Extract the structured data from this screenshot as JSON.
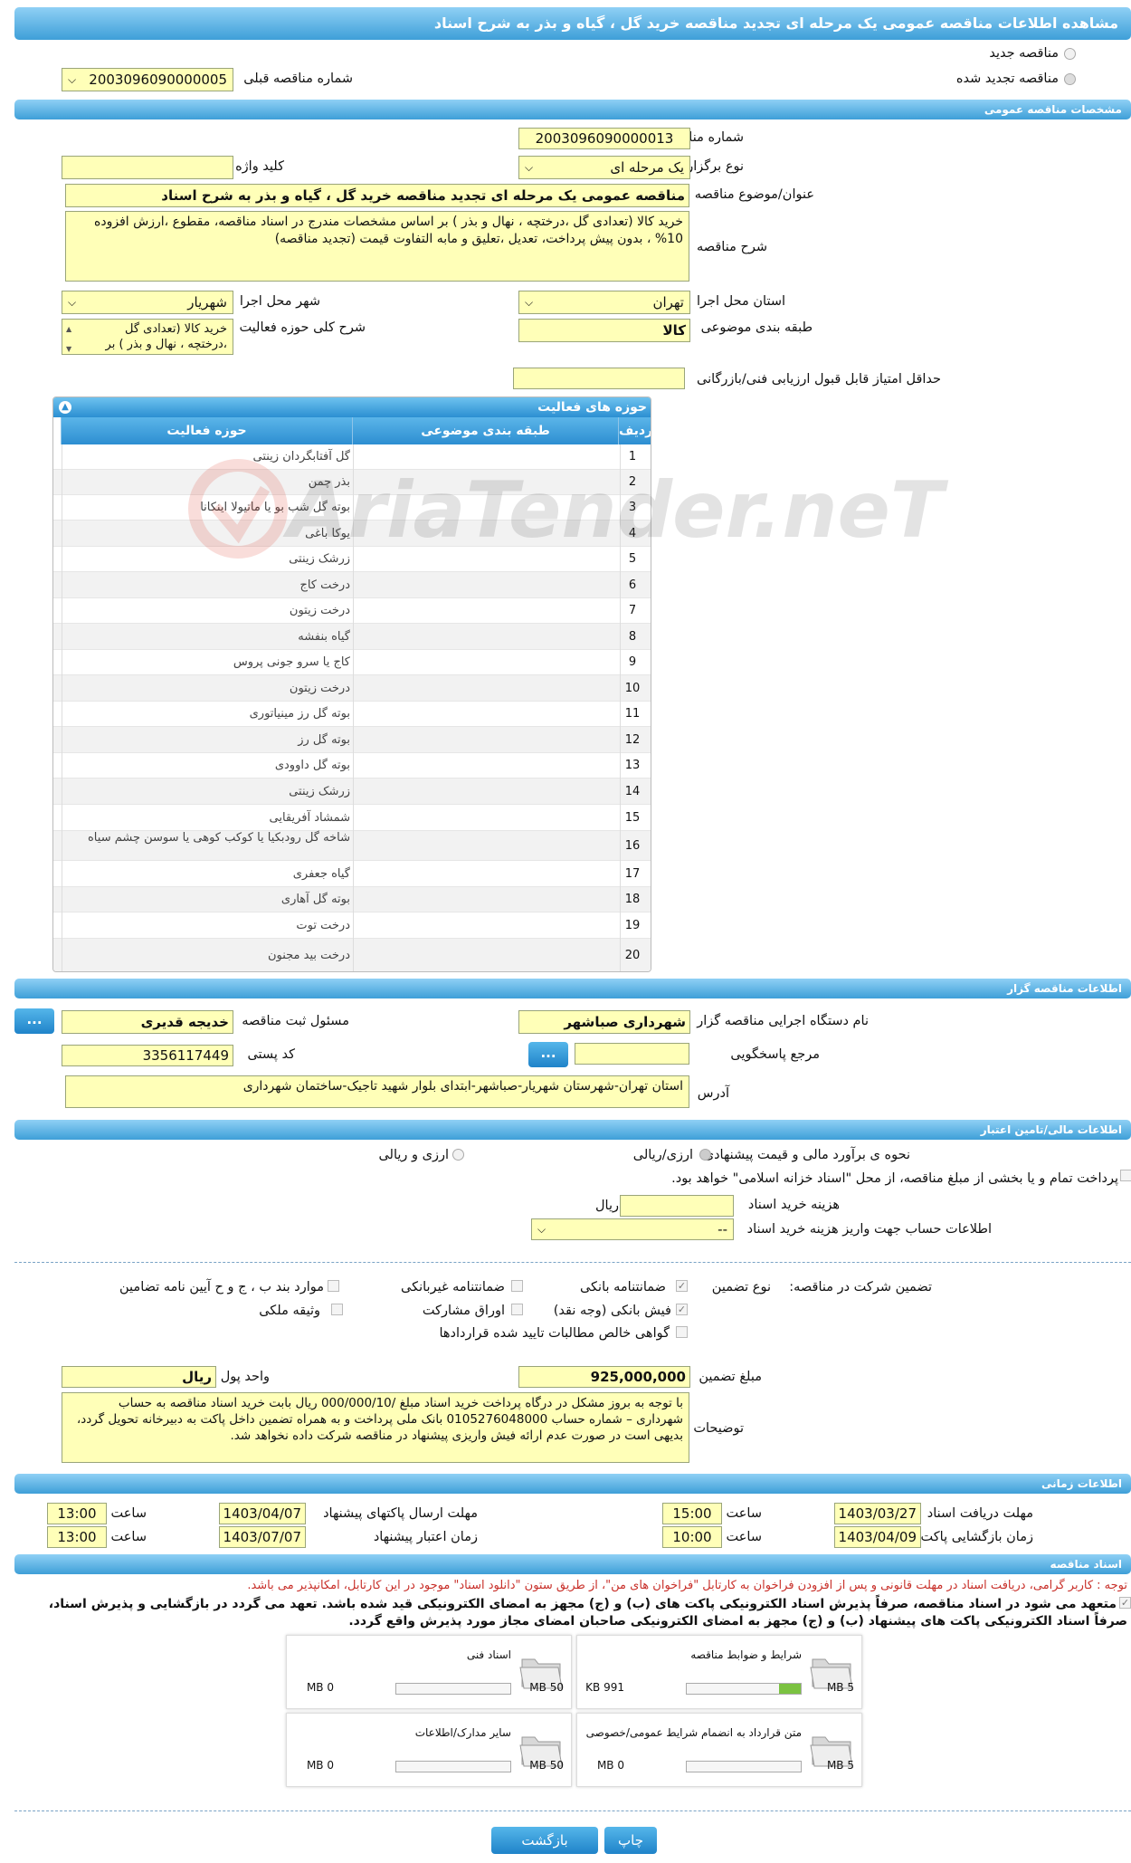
{
  "title": "مشاهده اطلاعات مناقصه عمومی یک مرحله ای تجدید مناقصه خرید گل ، گیاه و بذر به شرح اسناد",
  "radios": {
    "new": "مناقصه جدید",
    "renewed": "مناقصه تجدید شده"
  },
  "prev_tender": {
    "label": "شماره مناقصه قبلی",
    "value": "2003096090000005"
  },
  "sections": {
    "general": "مشخصات مناقصه عمومی",
    "organizer": "اطلاعات مناقصه گزار",
    "finance": "اطلاعات مالی/تامین اعتبار",
    "timing": "اطلاعات زمانی",
    "docs": "اسناد مناقصه"
  },
  "general": {
    "tender_no_label": "شماره مناقصه",
    "tender_no": "2003096090000013",
    "holding_type_label": "نوع برگزاری",
    "holding_type": "یک مرحله ای",
    "keyword_label": "کلید واژه",
    "keyword": "",
    "subject_label": "عنوان/موضوع مناقصه",
    "subject": "مناقصه عمومی یک مرحله ای تجدید مناقصه خرید گل ، گیاه و بذر به شرح اسناد",
    "desc_label": "شرح مناقصه",
    "desc": "خرید کالا (تعدادی گل ،درختچه ، نهال و بذر ) بر اساس مشخصات مندرج در اسناد مناقصه، مقطوع ،ارزش افزوده 10% ، بدون پیش پرداخت، تعدیل ،تعلیق و مابه التفاوت قیمت (تجدید مناقصه)",
    "province_label": "استان محل اجرا",
    "province": "تهران",
    "city_label": "شهر محل اجرا",
    "city": "شهریار",
    "category_label": "طبقه بندی موضوعی",
    "category": "کالا",
    "activity_desc_label": "شرح کلی حوزه فعالیت",
    "activity_desc": "خرید کالا (تعدادی گل ،درختچه ، نهال و بذر ) بر",
    "min_score_label": "حداقل امتیاز قابل قبول ارزیابی فنی/بازرگانی",
    "min_score": ""
  },
  "grid": {
    "title": "حوزه های فعالیت",
    "col_row": "ردیف",
    "col_cat": "طبقه بندی موضوعی",
    "col_act": "حوزه فعالیت",
    "rows": [
      {
        "n": "1",
        "a": "گل آفتابگردان زینتی"
      },
      {
        "n": "2",
        "a": "بذر چمن"
      },
      {
        "n": "3",
        "a": "بوته گل شب بو یا ماتیولا اینکانا"
      },
      {
        "n": "4",
        "a": "یوکا باغی"
      },
      {
        "n": "5",
        "a": "زرشک زینتی"
      },
      {
        "n": "6",
        "a": "درخت کاج"
      },
      {
        "n": "7",
        "a": "درخت زیتون"
      },
      {
        "n": "8",
        "a": "گیاه بنفشه"
      },
      {
        "n": "9",
        "a": "کاج یا سرو جونی پروس"
      },
      {
        "n": "10",
        "a": "درخت زیتون"
      },
      {
        "n": "11",
        "a": "بوته گل رز مینیاتوری"
      },
      {
        "n": "12",
        "a": "بوته گل رز"
      },
      {
        "n": "13",
        "a": "بوته گل داوودی"
      },
      {
        "n": "14",
        "a": "زرشک زینتی"
      },
      {
        "n": "15",
        "a": "شمشاد آفریقایی"
      },
      {
        "n": "16",
        "a": "شاخه گل رودبکیا یا کوکب کوهی یا سوسن چشم سیاه"
      },
      {
        "n": "17",
        "a": "گیاه جعفری"
      },
      {
        "n": "18",
        "a": "بوته گل آهاری"
      },
      {
        "n": "19",
        "a": "درخت توت"
      },
      {
        "n": "20",
        "a": "درخت بید مجنون"
      }
    ]
  },
  "watermark": "AriaTender.neT",
  "organizer": {
    "org_label": "نام دستگاه اجرایی مناقصه گزار",
    "org": "شهرداری صباشهر",
    "resp_label": "مسئول ثبت مناقصه",
    "resp": "خدیجه قدیری",
    "ref_label": "مرجع پاسخگویی",
    "ref": "",
    "postal_label": "کد پستی",
    "postal": "3356117449",
    "address_label": "آدرس",
    "address": "استان تهران-شهرستان شهریار-صباشهر-ابتدای بلوار شهید تاجیک-ساختمان شهرداری",
    "more": "..."
  },
  "finance": {
    "estimate_label": "نحوه ی برآورد مالی و قیمت پیشنهادی",
    "opt_rial": "ارزی/ریالی",
    "opt_fx": "ارزی و ریالی",
    "treasury_text": "پرداخت تمام و یا بخشی از مبلغ مناقصه، از محل \"اسناد خزانه اسلامی\" خواهد بود.",
    "doc_fee_label": "هزینه خرید اسناد",
    "doc_fee": "",
    "doc_fee_unit": "ریال",
    "account_label": "اطلاعات حساب جهت واریز هزینه خرید اسناد",
    "account": "--",
    "guarantee_label": "تضمین شرکت در مناقصه:",
    "guarantee_type_label": "نوع تضمین",
    "g_bank": "ضمانتنامه بانکی",
    "g_nonbank": "ضمانتنامه غیربانکی",
    "g_other": "موارد بند ب ، ج و ح آیین نامه تضامین",
    "g_check": "فیش بانکی (وجه نقد)",
    "g_bonds": "اوراق مشارکت",
    "g_property": "وثیقه ملکی",
    "g_claims": "گواهی خالص مطالبات تایید شده قراردادها",
    "amount_label": "مبلغ تضمین",
    "amount": "925,000,000",
    "currency_label": "واحد پول",
    "currency": "ریال",
    "notes_label": "توضیحات",
    "notes": "با توجه به بروز مشکل در درگاه پرداخت خرید اسناد مبلغ /000/000/10 ریال بابت خرید اسناد مناقصه به حساب شهرداری – شماره حساب 0105276048000 بانک ملی پرداخت و به همراه تضمین داخل پاکت به دبیرخانه تحویل گردد، بدیهی است در صورت عدم ارائه فیش واریزی پیشنهاد در مناقصه شرکت داده نخواهد شد."
  },
  "timing": {
    "doc_deadline_label": "مهلت دریافت اسناد",
    "doc_deadline": "1403/03/27",
    "time_label": "ساعت",
    "doc_time": "15:00",
    "send_deadline_label": "مهلت ارسال پاکتهای پیشنهاد",
    "send_deadline": "1403/04/07",
    "send_time": "13:00",
    "open_label": "زمان بازگشایی پاکت ها",
    "open_date": "1403/04/09",
    "open_time": "10:00",
    "valid_label": "زمان اعتبار پیشنهاد",
    "valid_date": "1403/07/07",
    "valid_time": "13:00"
  },
  "docs": {
    "notice": "توجه : کاربر گرامی، دریافت اسناد در مهلت قانونی و پس از افزودن فراخوان به کارتابل \"فراخوان های من\"، از طریق ستون \"دانلود اسناد\" موجود در این کارتابل، امکانپذیر می باشد.",
    "commit1": "متعهد می شود در اسناد مناقصه، صرفاً پذیرش اسناد الکترونیکی پاکت های (ب) و (ج) مجهز به امضای الکترونیکی قید شده باشد. تعهد می گردد در بازگشایی و پذیرش اسناد،",
    "commit2": "صرفاً اسناد الکترونیکی پاکت های پیشنهاد (ب) و (ج) مجهز به امضای الکترونیکی صاحبان امضای مجاز مورد پذیرش واقع گردد.",
    "files": [
      {
        "name": "شرایط و ضوابط مناقصه",
        "used": "991 KB",
        "max": "5 MB",
        "frac": 0.19
      },
      {
        "name": "اسناد فنی",
        "used": "0 MB",
        "max": "50 MB",
        "frac": 0
      },
      {
        "name": "متن قرارداد به انضمام شرایط عمومی/خصوصی",
        "used": "0 MB",
        "max": "5 MB",
        "frac": 0
      },
      {
        "name": "سایر مدارک/اطلاعات",
        "used": "0 MB",
        "max": "50 MB",
        "frac": 0
      }
    ]
  },
  "buttons": {
    "print": "چاپ",
    "back": "بازگشت"
  }
}
